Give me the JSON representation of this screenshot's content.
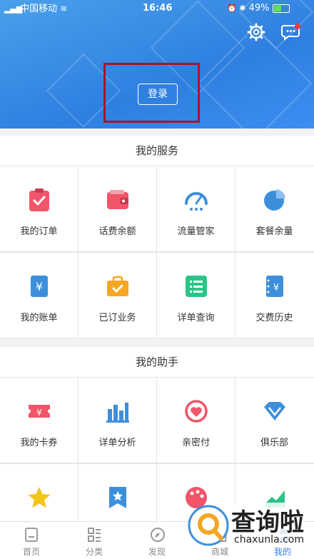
{
  "status_bar": {
    "carrier": "中国移动",
    "time": "16:46",
    "battery": "49%"
  },
  "header": {
    "login_label": "登录"
  },
  "services": {
    "title": "我的服务",
    "items": [
      {
        "label": "我的订单",
        "icon": "clipboard-check-icon",
        "color": "#f0556a"
      },
      {
        "label": "话费余额",
        "icon": "wallet-icon",
        "color": "#f0556a"
      },
      {
        "label": "流量管家",
        "icon": "speedometer-icon",
        "color": "#3d8fdc"
      },
      {
        "label": "套餐余量",
        "icon": "pie-chart-icon",
        "color": "#3d8fdc"
      },
      {
        "label": "我的账单",
        "icon": "yuan-bill-icon",
        "color": "#3d8fdc"
      },
      {
        "label": "已订业务",
        "icon": "briefcase-check-icon",
        "color": "#f5a623"
      },
      {
        "label": "详单查询",
        "icon": "list-icon",
        "color": "#2cc486"
      },
      {
        "label": "交费历史",
        "icon": "yuan-notebook-icon",
        "color": "#3d8fdc"
      }
    ]
  },
  "assistant": {
    "title": "我的助手",
    "items": [
      {
        "label": "我的卡券",
        "icon": "ticket-icon",
        "color": "#f0556a"
      },
      {
        "label": "详单分析",
        "icon": "bar-chart-icon",
        "color": "#3d8fdc"
      },
      {
        "label": "亲密付",
        "icon": "heart-cycle-icon",
        "color": "#f0556a"
      },
      {
        "label": "俱乐部",
        "icon": "diamond-icon",
        "color": "#3d8fdc"
      },
      {
        "label": "",
        "icon": "star-icon",
        "color": "#f5c518"
      },
      {
        "label": "",
        "icon": "bookmark-star-icon",
        "color": "#3d8fdc"
      },
      {
        "label": "",
        "icon": "palette-icon",
        "color": "#f0556a"
      },
      {
        "label": "",
        "icon": "green-shape-icon",
        "color": "#2cc486"
      }
    ]
  },
  "nav": {
    "items": [
      {
        "label": "首页",
        "icon": "home-icon"
      },
      {
        "label": "分类",
        "icon": "category-icon"
      },
      {
        "label": "发现",
        "icon": "compass-icon"
      },
      {
        "label": "商城",
        "icon": "shop-icon"
      },
      {
        "label": "我的",
        "icon": "user-icon",
        "active": true
      }
    ],
    "active_color": "#2f7fe0"
  },
  "watermark": {
    "brand": "查询啦",
    "url": "chaxunla.com"
  }
}
